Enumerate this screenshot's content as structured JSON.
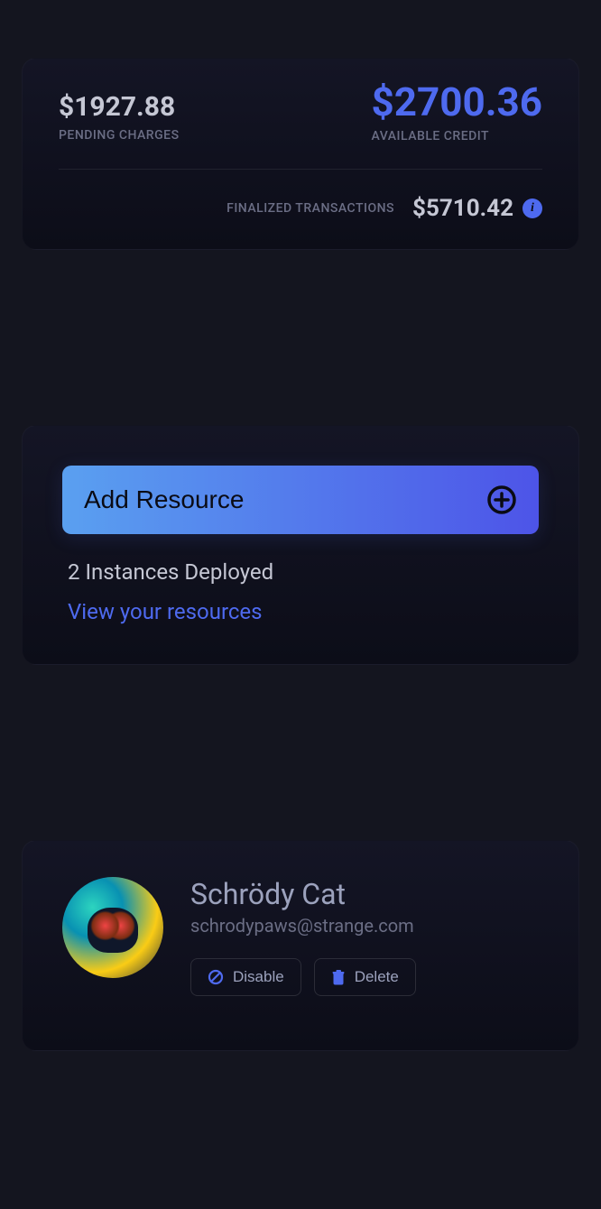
{
  "balance": {
    "pending_amount": "$1927.88",
    "pending_label": "PENDING CHARGES",
    "credit_amount": "$2700.36",
    "credit_label": "AVAILABLE CREDIT",
    "finalized_label": "FINALIZED TRANSACTIONS",
    "finalized_amount": "$5710.42"
  },
  "resources": {
    "add_label": "Add Resource",
    "deployed_text": "2 Instances Deployed",
    "view_link": "View your resources"
  },
  "user": {
    "name": "Schrödy Cat",
    "email": "schrodypaws@strange.com",
    "disable_label": "Disable",
    "delete_label": "Delete"
  }
}
